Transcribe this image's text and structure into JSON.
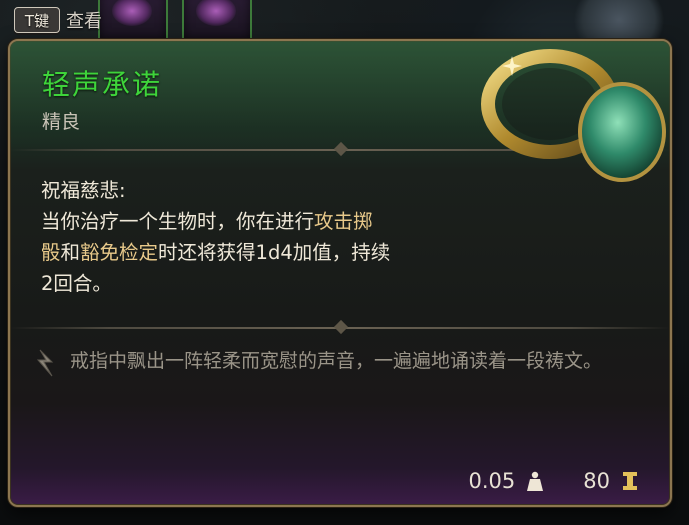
{
  "hint": {
    "key_label": "T键",
    "action_label": "查看"
  },
  "item": {
    "name": "轻声承诺",
    "rarity": "精良",
    "ability_title": "祝福慈悲:",
    "ability_line1_a": "当你治疗一个生物时，你在进行",
    "ability_line1_kw": "攻击掷",
    "ability_line2_kw": "骰",
    "ability_line2_a": "和",
    "ability_line2_kw2": "豁免检定",
    "ability_line2_b": "时还将获得1d4加值，持续",
    "ability_line3": "2回合。",
    "flavor": "戒指中飘出一阵轻柔而宽慰的声音，一遍遍地诵读着一段祷文。",
    "weight": "0.05",
    "value": "80"
  },
  "colors": {
    "rarity_name": "#3ed43a",
    "keyword": "#e8c98a",
    "border": "#8c7650"
  },
  "icons": {
    "weight": "weight-icon",
    "gold": "gold-icon",
    "flavor": "quill-icon",
    "item": "ring-icon"
  }
}
